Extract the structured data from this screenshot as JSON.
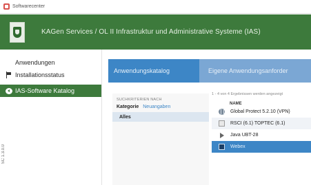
{
  "window": {
    "title": "Softwarecenter"
  },
  "header": {
    "title": "KAGen Services / OL II Infrastruktur und Administrative Systeme (IAS)"
  },
  "sidebar": {
    "items": [
      {
        "label": "Anwendungen",
        "icon": "grid-icon"
      },
      {
        "label": "Installationsstatus",
        "icon": "flag-icon"
      },
      {
        "label": "IAS-Software Katalog",
        "icon": "disc-back-icon"
      }
    ],
    "vertical_label": "SC 1.3.0.0"
  },
  "tabs": [
    {
      "label": "Anwendungskatalog"
    },
    {
      "label": "Eigene Anwendungsanforder"
    }
  ],
  "filters": {
    "heading": "SUCHKRITERIEN NACH",
    "category_label": "Kategorie",
    "reset_label": "Neuangaben",
    "all_label": "Alles"
  },
  "results": {
    "info": "1 - 4 von 4 Ergebnissen werden angezeigt",
    "column_name": "NAME",
    "rows": [
      {
        "name": "Global Protect 5.2.10 (VPN)",
        "icon": "globe-icon"
      },
      {
        "name": "RSCI (6.1) TOPTEC (6.1)",
        "icon": "package-icon"
      },
      {
        "name": "Java UBT-28",
        "icon": "play-icon"
      },
      {
        "name": "Webex",
        "icon": "window-icon"
      }
    ]
  },
  "colors": {
    "header_green": "#3d7a3c",
    "tab_active_blue": "#3d86c6",
    "tabbar_blue": "#7ba7d4",
    "selected_row_blue": "#3d86c6"
  }
}
